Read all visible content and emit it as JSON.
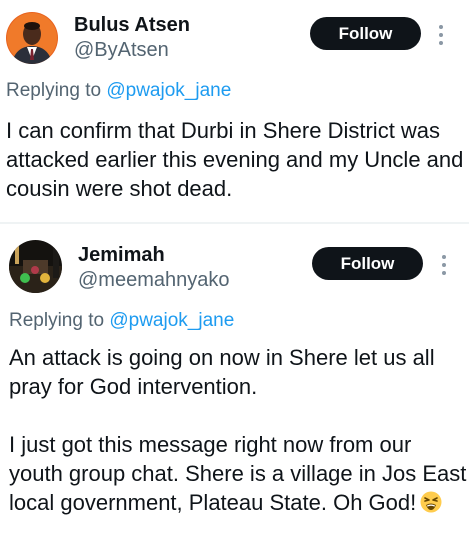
{
  "tweets": [
    {
      "author_name": "Bulus Atsen",
      "handle": "@ByAtsen",
      "follow_label": "Follow",
      "reply_prefix": "Replying to",
      "reply_to": "@pwajok_jane",
      "paragraphs": [
        "I can confirm that Durbi in Shere District was attacked earlier this evening and my Uncle and cousin were shot dead."
      ],
      "avatar_icon": "profile-photo-man-suit"
    },
    {
      "author_name": "Jemimah",
      "handle": "@meemahnyako",
      "follow_label": "Follow",
      "reply_prefix": "Replying to",
      "reply_to": "@pwajok_jane",
      "paragraphs": [
        "An attack is going on now in Shere let us all pray for God intervention.",
        "I just got this message right now from our youth group chat. Shere is a village in Jos East local government, Plateau State. Oh God!"
      ],
      "trailing_emoji_icon": "tired-face-emoji",
      "avatar_icon": "profile-photo-dark-room"
    }
  ],
  "colors": {
    "follow_bg": "#0f1419",
    "mention": "#1d9bf0",
    "secondary_text": "#536471",
    "divider": "#eff3f4"
  }
}
